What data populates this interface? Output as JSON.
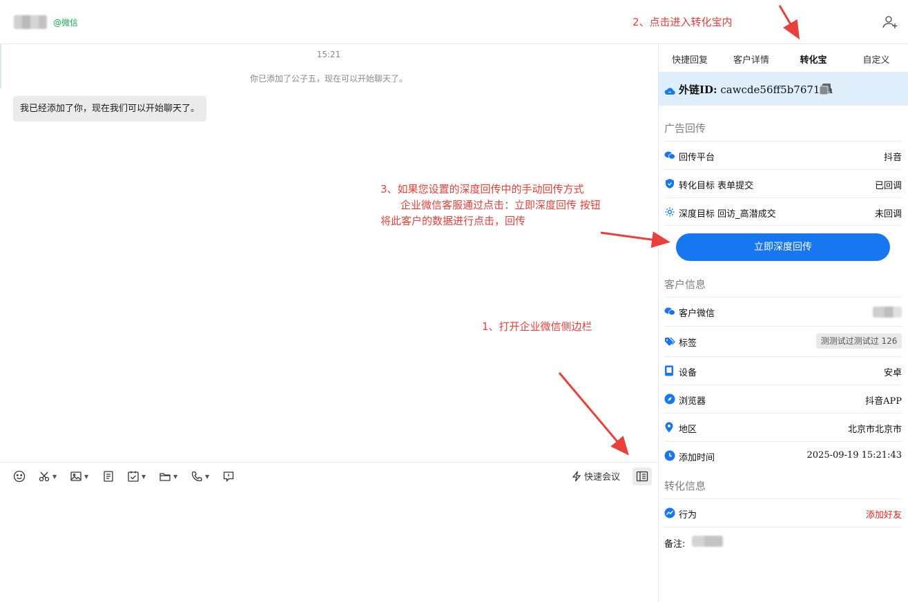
{
  "header": {
    "wechat_tag": "@微信"
  },
  "chat": {
    "time": "15:21",
    "system_message": "你已添加了公子五，现在可以开始聊天了。",
    "message": "我已经添加了你，现在我们可以开始聊天了。"
  },
  "toolbar": {
    "quick_meeting": "快速会议"
  },
  "panel": {
    "tabs": [
      "快捷回复",
      "客户详情",
      "转化宝",
      "自定义"
    ],
    "active_tab": "转化宝",
    "external_id_label": "外链ID:",
    "external_id_value": "cawcde56ff5b76717a",
    "ad_section": "广告回传",
    "ad_rows": [
      {
        "label": "回传平台",
        "value": "抖音"
      },
      {
        "label": "转化目标 表单提交",
        "value": "已回调"
      },
      {
        "label": "深度目标 回访_高潜成交",
        "value": "未回调"
      }
    ],
    "deep_button": "立即深度回传",
    "customer_section": "客户信息",
    "customer_rows": [
      {
        "label": "客户微信",
        "value": ""
      },
      {
        "label": "标签",
        "value": "测测试过测试过 126"
      },
      {
        "label": "设备",
        "value": "安卓"
      },
      {
        "label": "浏览器",
        "value": "抖音APP"
      },
      {
        "label": "地区",
        "value": "北京市北京市"
      },
      {
        "label": "添加时间",
        "value": "2025-09-19 15:21:43"
      }
    ],
    "conversion_section": "转化信息",
    "conversion_rows": [
      {
        "label": "行为",
        "value": "添加好友"
      }
    ],
    "note_label": "备注:"
  },
  "annotations": {
    "step1": "1、打开企业微信侧边栏",
    "step2": "2、点击进入转化宝内",
    "step3_line1": "3、如果您设置的深度回传中的手动回传方式",
    "step3_line2": "企业微信客服通过点击：立即深度回传 按钮",
    "step3_line3": "将此客户的数据进行点击，回传"
  },
  "colors": {
    "accent": "#1677f0",
    "annotation": "#e8403a",
    "wechat_green": "#19a857",
    "alert_red": "#e8271e"
  }
}
